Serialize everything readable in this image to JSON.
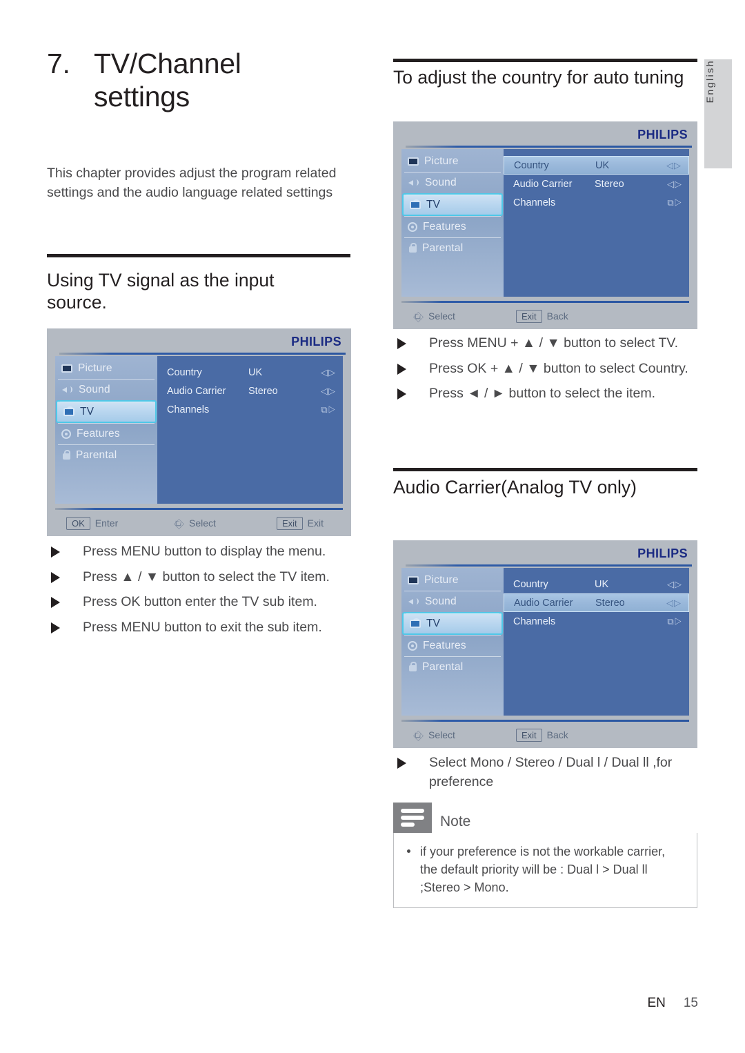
{
  "language_tab": {
    "label": "English"
  },
  "chapter": {
    "number": "7.",
    "title": "TV/Channel settings",
    "title_line1": "TV/Channel",
    "title_line2": "settings",
    "intro": "This chapter provides adjust the program related settings and the audio language related settings"
  },
  "left_section": {
    "heading": "Using TV signal as the input source.",
    "bullets": [
      "Press MENU button to display the menu.",
      "Press ▲ / ▼ button to select the TV item.",
      "Press OK button enter the TV sub item.",
      "Press MENU button to exit the sub item."
    ]
  },
  "right_section_country": {
    "heading": "To adjust the country for auto tuning",
    "bullets": [
      "Press MENU + ▲ / ▼ button to select TV.",
      "Press OK + ▲ / ▼ button to select Country.",
      "Press ◄ / ► button to select the item."
    ]
  },
  "right_section_audio": {
    "heading": "Audio Carrier(Analog TV only)",
    "bullets": [
      "Select Mono / Stereo / Dual l / Dual ll ,for preference"
    ]
  },
  "note": {
    "label": "Note",
    "items": [
      "if your preference is not the workable carrier, the default priority will be : Dual l > Dual ll ;Stereo > Mono."
    ]
  },
  "osd_common": {
    "brand": "PHILIPS",
    "sidebar": [
      {
        "label": "Picture",
        "icon": "picture-icon"
      },
      {
        "label": "Sound",
        "icon": "sound-icon"
      },
      {
        "label": "TV",
        "icon": "tv-icon"
      },
      {
        "label": "Features",
        "icon": "features-icon"
      },
      {
        "label": "Parental",
        "icon": "parental-icon"
      }
    ],
    "active_sidebar": "TV",
    "options": [
      {
        "key": "Country",
        "value": "UK",
        "arrows": "◁▷"
      },
      {
        "key": "Audio Carrier",
        "value": "Stereo",
        "arrows": "◁▷"
      },
      {
        "key": "Channels",
        "value": "",
        "arrows": "⧉▷"
      }
    ]
  },
  "osd_1": {
    "selected_option": "",
    "footer": [
      {
        "key": "OK",
        "action": "Enter",
        "icon": "keycap"
      },
      {
        "key": "",
        "action": "Select",
        "icon": "nav-diamond-icon"
      },
      {
        "key": "Exit",
        "action": "Exit",
        "icon": "keycap"
      }
    ]
  },
  "osd_2": {
    "selected_option": "Country",
    "footer": [
      {
        "key": "",
        "action": "Select",
        "icon": "nav-diamond-icon"
      },
      {
        "key": "Exit",
        "action": "Back",
        "icon": "keycap"
      }
    ]
  },
  "osd_3": {
    "selected_option": "Audio Carrier",
    "footer": [
      {
        "key": "",
        "action": "Select",
        "icon": "nav-diamond-icon"
      },
      {
        "key": "Exit",
        "action": "Back",
        "icon": "keycap"
      }
    ]
  },
  "footer": {
    "lang_code": "EN",
    "page_number": "15"
  },
  "colors": {
    "brand_blue": "#1b2b83",
    "osd_bg": "#b4bac2",
    "osd_main": "#4a6ba5",
    "highlight_cyan": "#4fc8e8",
    "note_gray": "#808184"
  }
}
